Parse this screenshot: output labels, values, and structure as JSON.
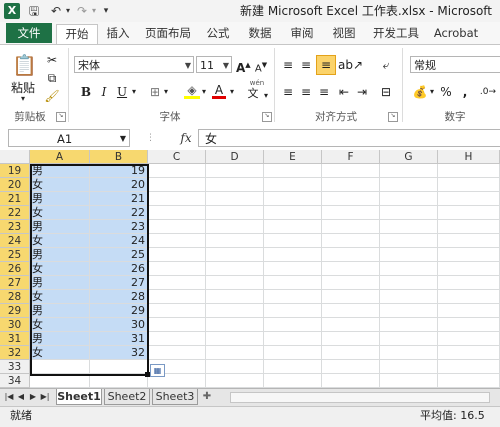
{
  "app": {
    "icon_letter": "X",
    "window_title": "新建 Microsoft Excel 工作表.xlsx - Microsoft"
  },
  "quick_access": {
    "save_icon": "save-icon",
    "undo_icon": "undo-icon",
    "redo_icon": "redo-icon",
    "customize_icon": "chevron-down-icon"
  },
  "ribbon_tabs": [
    {
      "label": "文件"
    },
    {
      "label": "开始"
    },
    {
      "label": "插入"
    },
    {
      "label": "页面布局"
    },
    {
      "label": "公式"
    },
    {
      "label": "数据"
    },
    {
      "label": "审阅"
    },
    {
      "label": "视图"
    },
    {
      "label": "开发工具"
    },
    {
      "label": "Acrobat"
    }
  ],
  "ribbon": {
    "clipboard": {
      "paste_label": "粘贴",
      "group_label": "剪贴板"
    },
    "font": {
      "font_name": "宋体",
      "font_size": "11",
      "group_label": "字体",
      "bold": "B",
      "italic": "I",
      "underline": "U",
      "font_color_letter": "A",
      "wen": "wén"
    },
    "alignment": {
      "group_label": "对齐方式"
    },
    "number": {
      "format": "常规",
      "group_label": "数字",
      "percent": "%",
      "comma": ","
    }
  },
  "formula_bar": {
    "name_box": "A1",
    "fx_label": "fx",
    "content": "女"
  },
  "columns": [
    "A",
    "B",
    "C",
    "D",
    "E",
    "F",
    "G",
    "H"
  ],
  "rows": [
    {
      "num": "19",
      "a": "男",
      "b": "19"
    },
    {
      "num": "20",
      "a": "女",
      "b": "20"
    },
    {
      "num": "21",
      "a": "男",
      "b": "21"
    },
    {
      "num": "22",
      "a": "女",
      "b": "22"
    },
    {
      "num": "23",
      "a": "男",
      "b": "23"
    },
    {
      "num": "24",
      "a": "女",
      "b": "24"
    },
    {
      "num": "25",
      "a": "男",
      "b": "25"
    },
    {
      "num": "26",
      "a": "女",
      "b": "26"
    },
    {
      "num": "27",
      "a": "男",
      "b": "27"
    },
    {
      "num": "28",
      "a": "女",
      "b": "28"
    },
    {
      "num": "29",
      "a": "男",
      "b": "29"
    },
    {
      "num": "30",
      "a": "女",
      "b": "30"
    },
    {
      "num": "31",
      "a": "男",
      "b": "31"
    },
    {
      "num": "32",
      "a": "女",
      "b": "32"
    },
    {
      "num": "33",
      "a": "",
      "b": ""
    },
    {
      "num": "34",
      "a": "",
      "b": ""
    }
  ],
  "sheets": [
    {
      "label": "Sheet1"
    },
    {
      "label": "Sheet2"
    },
    {
      "label": "Sheet3"
    }
  ],
  "status": {
    "ready": "就绪",
    "average": "平均值: 16.5"
  },
  "colors": {
    "excel_green": "#1e7145",
    "selection_fill": "#c5dcf5",
    "header_highlight": "#f7d86f"
  }
}
